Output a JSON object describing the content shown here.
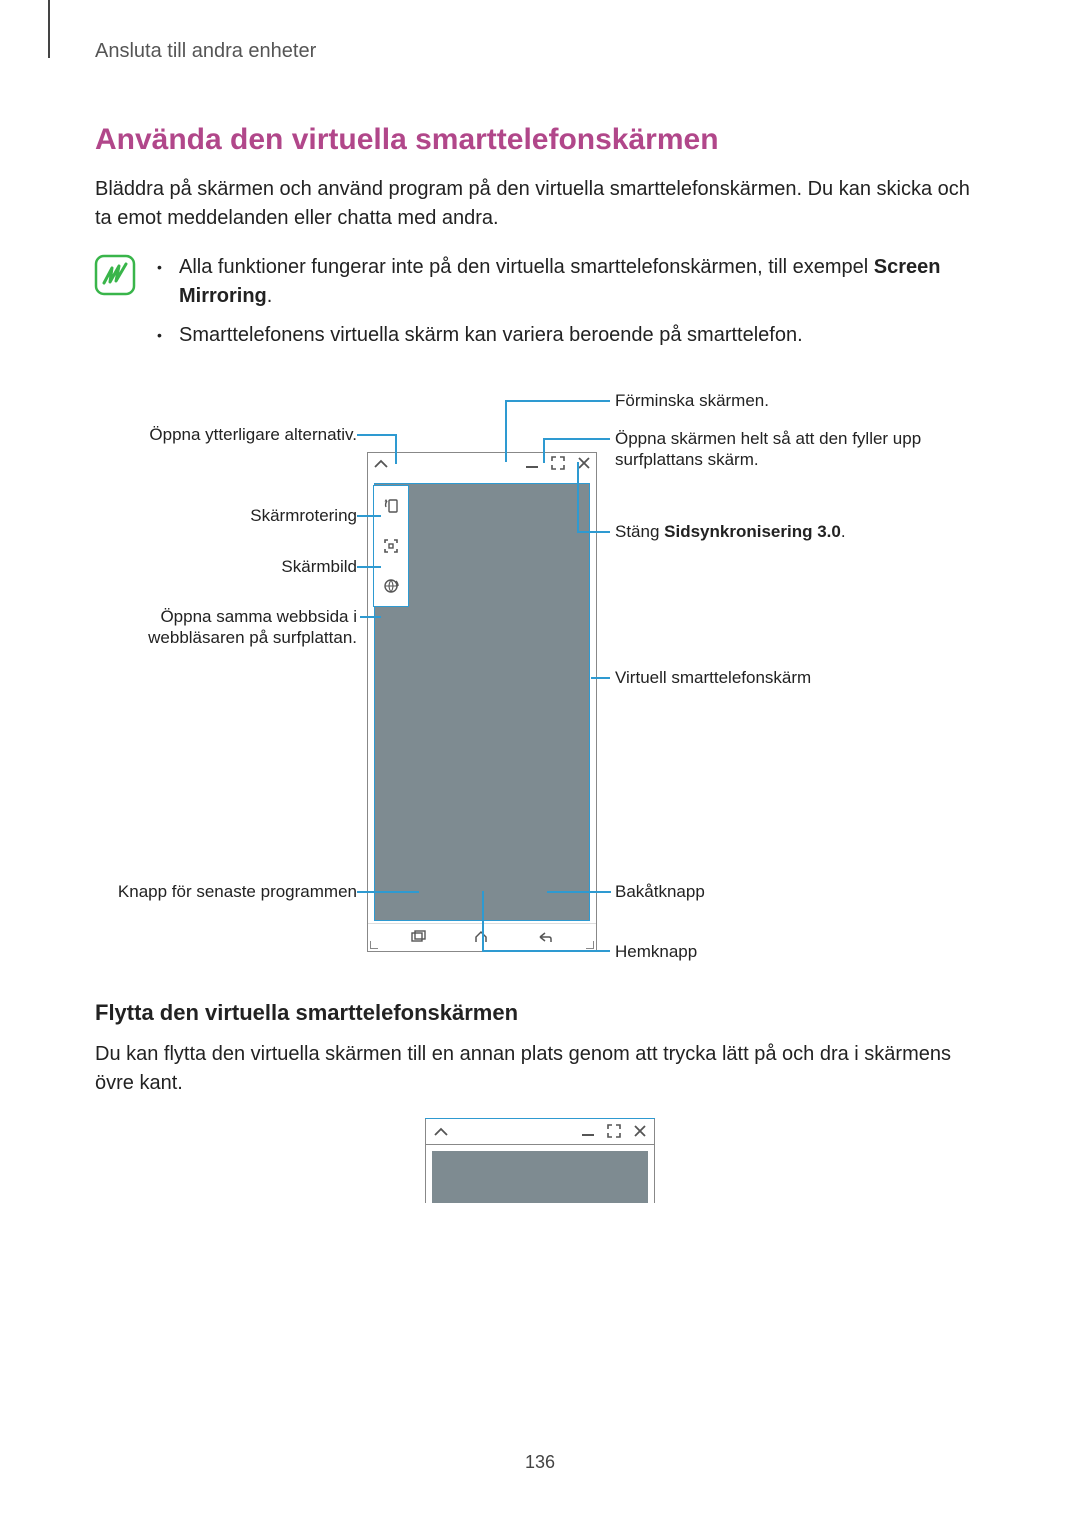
{
  "header": {
    "breadcrumb": "Ansluta till andra enheter"
  },
  "section": {
    "title": "Använda den virtuella smarttelefonskärmen",
    "intro": "Bläddra på skärmen och använd program på den virtuella smarttelefonskärmen. Du kan skicka och ta emot meddelanden eller chatta med andra."
  },
  "note": {
    "item1_prefix": "Alla funktioner fungerar inte på den virtuella smarttelefonskärmen, till exempel ",
    "item1_bold": "Screen Mirroring",
    "item1_suffix": ".",
    "item2": "Smarttelefonens virtuella skärm kan variera beroende på smarttelefon."
  },
  "callouts": {
    "open_more": "Öppna ytterligare alternativ.",
    "rotate": "Skärmrotering",
    "screenshot": "Skärmbild",
    "same_web": "Öppna samma webbsida i webbläsaren på surfplattan.",
    "recent": "Knapp för senaste programmen",
    "minimize": "Förminska skärmen.",
    "fullscreen": "Öppna skärmen helt så att den fyller upp surfplattans skärm.",
    "close_prefix": "Stäng ",
    "close_bold": "Sidsynkronisering 3.0",
    "close_suffix": ".",
    "virtual": "Virtuell smarttelefonskärm",
    "back": "Bakåtknapp",
    "home": "Hemknapp"
  },
  "subsection": {
    "title": "Flytta den virtuella smarttelefonskärmen",
    "body": "Du kan flytta den virtuella skärmen till en annan plats genom att trycka lätt på och dra i skärmens övre kant."
  },
  "icons": {
    "chevron_up": "chevron-up-icon",
    "minimize": "minimize-icon",
    "expand": "expand-icon",
    "close": "close-icon",
    "rotate": "rotate-icon",
    "screenshot": "screenshot-icon",
    "globe": "globe-refresh-icon",
    "recent": "recent-apps-icon",
    "home": "home-icon",
    "back": "back-icon",
    "note": "note-icon"
  },
  "page_number": "136"
}
